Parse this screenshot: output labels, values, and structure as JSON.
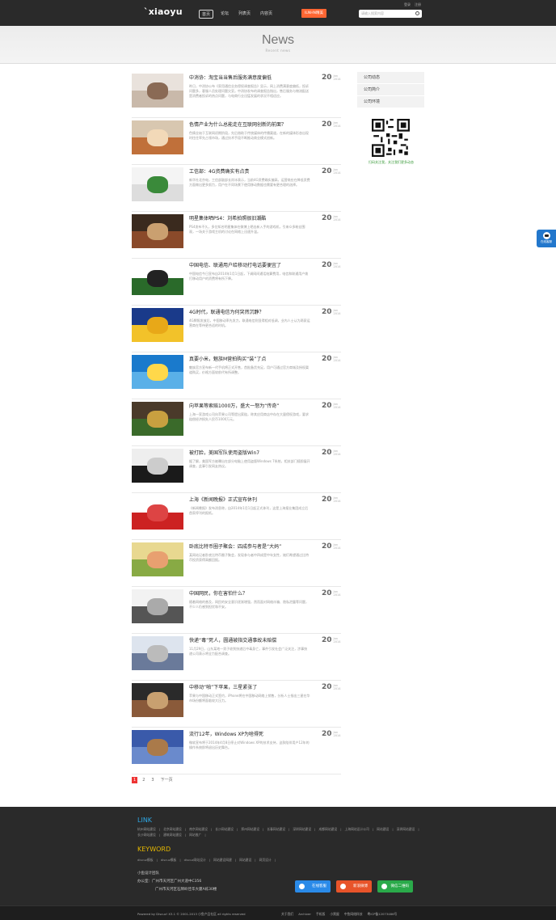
{
  "header": {
    "logo": "`xiaoyu",
    "nav": [
      "首页",
      "论坛",
      "列表页",
      "内容页"
    ],
    "cta": "ILNHN精美",
    "search_placeholder": "请输入搜索内容",
    "top_links": [
      "登录",
      "注册"
    ]
  },
  "banner": {
    "title": "News",
    "subtitle": "Recent news"
  },
  "articles": [
    {
      "title": "中消协：淘宝当当售后服务满意度偏低",
      "excerpt": "昨日，中消协公布《家用通信业务侵权调查报告》显示，网上消费满意度偏低，投诉问题多，客服人员处理问题欠妥。中消协发布的调查报告指出，售后服务与物流配送是消费者投诉的热点问题，与电商行业迅猛发展的状况不相适应。",
      "day": "20",
      "month": "Jan",
      "year": "2014",
      "colors": [
        "#e9e2dc",
        "#c9b9aa",
        "#8a6a55"
      ]
    },
    {
      "title": "色情产业为什么总能走在互联网创新的前面？",
      "excerpt": "色情业始于互联网初期阶段，先后借助于传统媒体的传播渠道，在新的媒体形态出现时往往率先占领市场，通过技术手段不断推动商业模式创新。",
      "day": "20",
      "month": "Jan",
      "year": "2014",
      "colors": [
        "#d8c7b0",
        "#c0703a",
        "#f2d9b8"
      ]
    },
    {
      "title": "工信部：4G资费确实有点贵",
      "excerpt": "新华社北京电，工信部副部长尚冰表示，当前4G资费确实偏高，运营商应在降低资费方面做出更多努力，用户在不同场景下使用移动数据也需要有更合理的选择。",
      "day": "20",
      "month": "Jan",
      "year": "2014",
      "colors": [
        "#f4f4f4",
        "#dddddd",
        "#3a8a3a"
      ]
    },
    {
      "title": "明星集体晒PS4：刘希拍照很旧潮酷",
      "excerpt": "PS4发布不久，多位知名明星集体在微博上晒出新入手的游戏机，引来众多粉丝围观，一场关于游戏主机的讨论在网络上迅速升温。",
      "day": "20",
      "month": "Jan",
      "year": "2014",
      "colors": [
        "#3a2a1e",
        "#8a4a2a",
        "#caa070"
      ]
    },
    {
      "title": "中国电信、联通用户给移动打电话要便宜了",
      "excerpt": "中国电信今日宣布自2014年1月1日起，下调网间通话结算费用，电信和联通用户拨打移动用户的资费将有所下降。",
      "day": "20",
      "month": "Jan",
      "year": "2014",
      "colors": [
        "#ffffff",
        "#2a6a2a",
        "#222222"
      ]
    },
    {
      "title": "4G时代，联通电信为何突然沉静？",
      "excerpt": "4G牌照发放后，中国移动率先发力，联通电信则显得相对低调，业内人士认为两家运营商在等待更合适的时机。",
      "day": "20",
      "month": "Jan",
      "year": "2014",
      "colors": [
        "#1a3a8a",
        "#f2c22a",
        "#e8a818"
      ]
    },
    {
      "title": "真要小米，魅族M营拍购买“装”了点",
      "excerpt": "魅族官方宣布新一代手机将正式开售，首批备货充足，用户可通过官方商城及授权渠道购买，价格方面较前代有所调整。",
      "day": "20",
      "month": "Jan",
      "year": "2014",
      "colors": [
        "#1a7acc",
        "#5ab0e8",
        "#ffd84a"
      ]
    },
    {
      "title": "向苹果等索赔1000万，盛大一怒为“传奇”",
      "excerpt": "上海一家游戏公司向苹果公司等提出索赔，称其应用商店中存在大量侵权游戏，要求赔偿经济损失人民币1000万元。",
      "day": "20",
      "month": "Jan",
      "year": "2014",
      "colors": [
        "#4a3a2a",
        "#3a6a2a",
        "#c8a040"
      ]
    },
    {
      "title": "被打脸，美国军队使用盗版Win7",
      "excerpt": "据了解，美国军方被曝出在部分电脑上使用盗版Windows 7系统，相关部门随即展开调查，此事引发网友热议。",
      "day": "20",
      "month": "Jan",
      "year": "2014",
      "colors": [
        "#eeeeee",
        "#1a1a1a",
        "#cccccc"
      ]
    },
    {
      "title": "上海《新闻晚报》正式宣布休刊",
      "excerpt": "《新闻晚报》发布消息称，自2014年1月1日起正式休刊，这是上海报业集团成立后首家停刊的报纸。",
      "day": "20",
      "month": "Jan",
      "year": "2014",
      "colors": [
        "#ffffff",
        "#cc2222",
        "#dd4444"
      ]
    },
    {
      "title": "卧底比特币圈子聚会：四成参与者是“大妈”",
      "excerpt": "某网站记者卧底比特币圈子聚会，发现参与者中四成是中年女性，她们希望通过比特币投资获得高额回报。",
      "day": "20",
      "month": "Jan",
      "year": "2014",
      "colors": [
        "#e8d890",
        "#88aa44",
        "#e8a070"
      ]
    },
    {
      "title": "中国网民，你在害怕什么？",
      "excerpt": "随着网络的普及，网民的安全意识逐渐增强，然而面对网络诈骗、隐私泄露等问题，不少人仍感到担忧和不安。",
      "day": "20",
      "month": "Jan",
      "year": "2014",
      "colors": [
        "#f2f2f2",
        "#555555",
        "#aaaaaa"
      ]
    },
    {
      "title": "快递“毒”死人，圆通被指交通事故未赔偿",
      "excerpt": "11月29日，山东某地一男子收到快递后中毒身亡，事件引发社会广泛关注，涉事快递公司表示将全力配合调查。",
      "day": "20",
      "month": "Jan",
      "year": "2014",
      "colors": [
        "#dde4ee",
        "#6a7a9a",
        "#bbbbbb"
      ]
    },
    {
      "title": "中移动“啪”下苹果，三星紧张了",
      "excerpt": "苹果与中国移动正式签约，iPhone将在中国移动网络上销售，分析人士指出三星在华市场份额将面临较大压力。",
      "day": "20",
      "month": "Jan",
      "year": "2014",
      "colors": [
        "#2a2a2a",
        "#8a5a3a",
        "#c8a070"
      ]
    },
    {
      "title": "流行12年，Windows XP为啥得死",
      "excerpt": "微软宣布将于2014年4月8日停止对Windows XP的技术支持，这款陪伴用户12年的操作系统即将退出历史舞台。",
      "day": "20",
      "month": "Jan",
      "year": "2014",
      "colors": [
        "#3a5aaa",
        "#6a8acc",
        "#aa7a4a"
      ]
    }
  ],
  "pager": {
    "pages": [
      "1",
      "2",
      "3"
    ],
    "next": "下一页"
  },
  "sidebar": {
    "items": [
      "公司动态",
      "公司简介",
      "公司环境"
    ],
    "qr_caption": "扫码关注我，关注我们更多动态"
  },
  "float_button": {
    "label": "在线客服"
  },
  "footer": {
    "link_heading": "LINK",
    "links": [
      "杭州网站建设",
      "北京网站建设",
      "南京网站建设",
      "长沙网站建设",
      "郑州网站建设",
      "长春网站建设",
      "深圳网站建设",
      "成都网站建设",
      "上海网站设计公司",
      "网站建设",
      "深圳网站建设",
      "长沙网站建设",
      "建筑网站建设",
      "网站推广"
    ],
    "keyword_heading": "KEYWORD",
    "keywords": [
      "discuz模板",
      "discuz模板",
      "discuz网站设计",
      "网站建设网建",
      "网站建设",
      "网页设计"
    ],
    "company_name": "小鱼设计团队",
    "address_label": "办公室：广州市天河区广州大道中C356",
    "address_line2": "广州市天河区石牌岭佳华大厦A栋30楼",
    "social": [
      {
        "label": "在线客服",
        "color": "#2a8ae8"
      },
      {
        "label": "新浪微博",
        "color": "#e8542a"
      },
      {
        "label": "微信二维码",
        "color": "#2aaa4a"
      }
    ],
    "copyright": "Powered by Discuz! X3.1 © 2001-2013 小鱼产品社区 all rights reserved",
    "bottom_links": [
      "关于我们",
      "Archiver",
      "手机版",
      "小黑屋",
      "中鱼网络科技",
      "粤ICP备12073486号"
    ]
  }
}
